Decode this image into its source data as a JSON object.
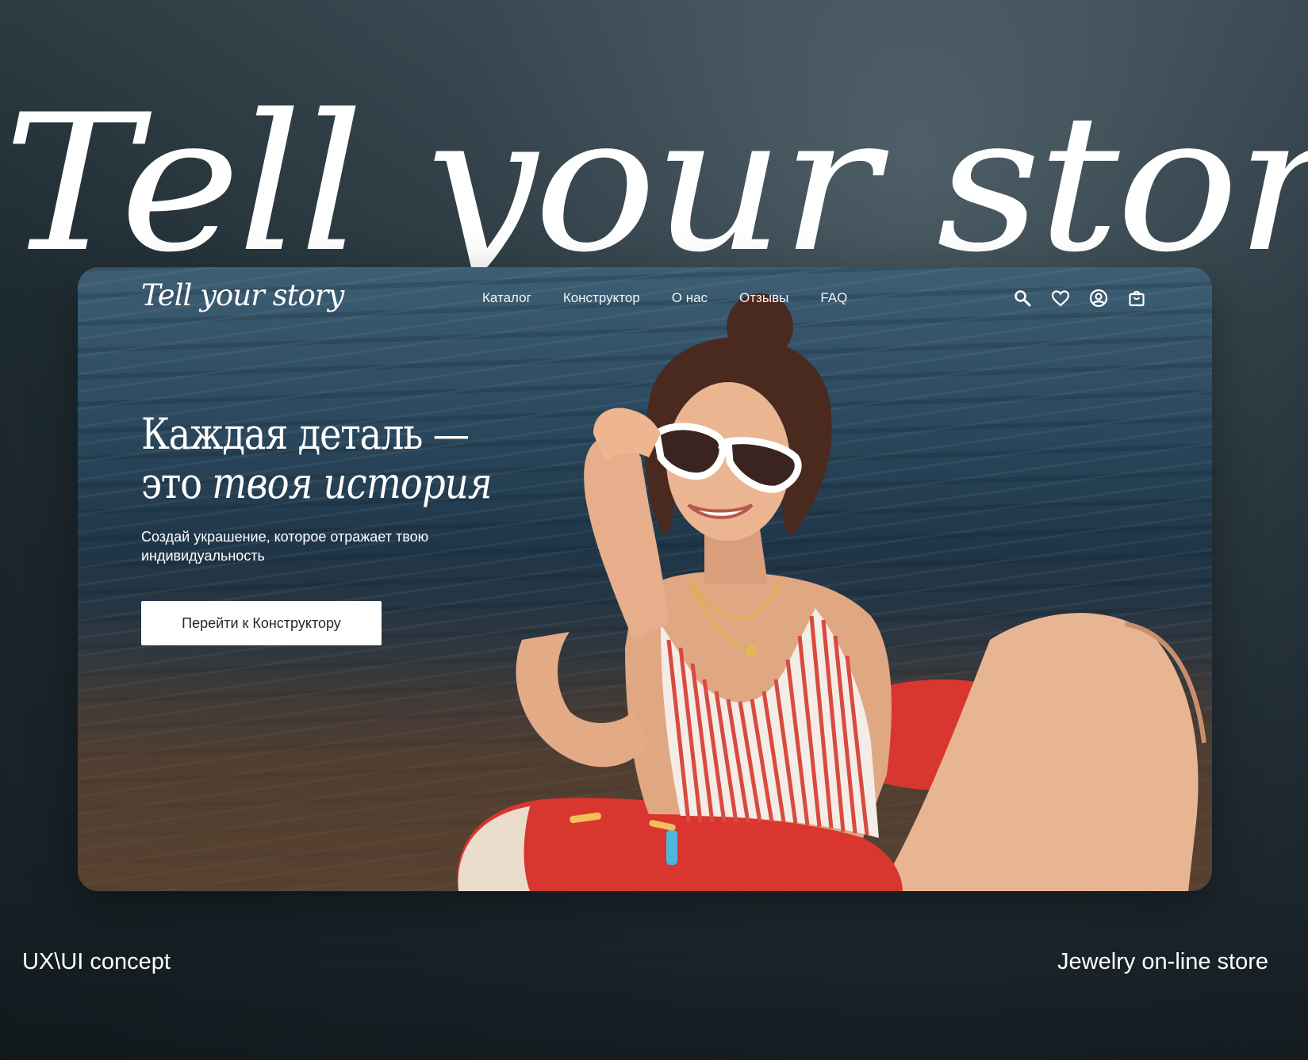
{
  "poster": {
    "title": "Tell your story",
    "caption_left": "UX\\UI concept",
    "caption_right": "Jewelry on-line store"
  },
  "site": {
    "logo": "Tell your story",
    "nav": {
      "items": [
        {
          "label": "Каталог"
        },
        {
          "label": "Конструктор"
        },
        {
          "label": "О нас"
        },
        {
          "label": "Отзывы"
        },
        {
          "label": "FAQ"
        }
      ],
      "icons": [
        "search-icon",
        "heart-icon",
        "user-icon",
        "shopping-bag-icon"
      ]
    },
    "hero": {
      "headline_line1": "Каждая деталь —",
      "headline_line2_plain": "это",
      "headline_line2_script": "твоя история",
      "subtext": "Создай украшение, которое отражает твою индивидуальность",
      "cta_label": "Перейти к Конструктору"
    }
  },
  "colors": {
    "background": "#1d2930",
    "text": "#ffffff",
    "button_bg": "#ffffff",
    "button_text": "#1c2a33",
    "swimsuit_stripe": "#d94a3f",
    "float_ring": "#d8362e"
  }
}
